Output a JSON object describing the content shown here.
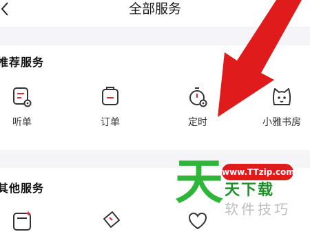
{
  "header": {
    "title": "全部服务",
    "back_icon": "chevron-left-icon"
  },
  "sections": [
    {
      "title": "推荐服务",
      "items": [
        {
          "label": "听单",
          "icon": "listen-list-icon"
        },
        {
          "label": "订单",
          "icon": "order-clipboard-icon"
        },
        {
          "label": "定时",
          "icon": "timer-icon"
        },
        {
          "label": "小雅书房",
          "icon": "cat-study-icon"
        }
      ]
    },
    {
      "title": "其他服务",
      "items": [
        {
          "label": "",
          "icon": "kaji-icon"
        },
        {
          "label": "",
          "icon": "ticket-icon"
        },
        {
          "label": "",
          "icon": "heart-icon"
        }
      ]
    }
  ],
  "colors": {
    "accent": "#e52a37",
    "arrow": "#e01b1b",
    "icon_stroke": "#333333",
    "watermark_green": "#2fb53a"
  },
  "watermark": {
    "bubble": "www.TTzip.com",
    "big": "天",
    "main": "天下载",
    "sub": "软件技巧"
  }
}
